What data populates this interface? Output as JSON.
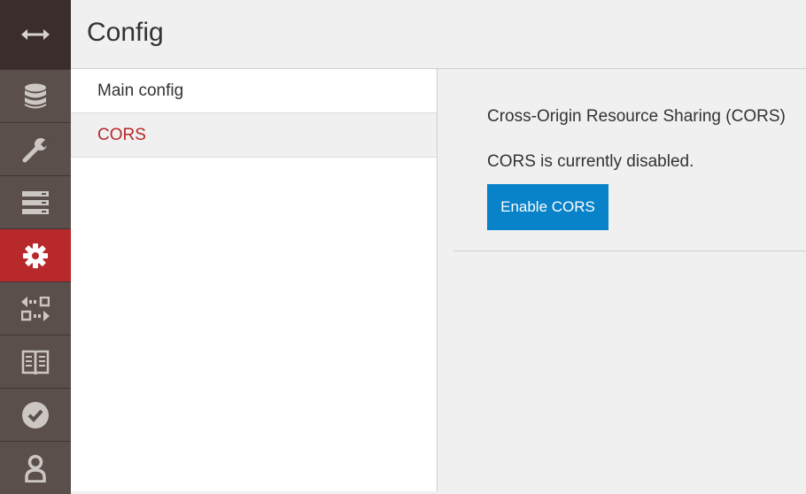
{
  "header": {
    "title": "Config"
  },
  "rail": {
    "items": [
      {
        "icon": "toggle-sidebar-icon"
      },
      {
        "icon": "database-icon"
      },
      {
        "icon": "wrench-icon"
      },
      {
        "icon": "server-icon"
      },
      {
        "icon": "gear-icon",
        "active": true
      },
      {
        "icon": "replication-icon"
      },
      {
        "icon": "book-icon"
      },
      {
        "icon": "check-circle-icon"
      },
      {
        "icon": "user-icon"
      }
    ],
    "active_color": "#b7292a"
  },
  "subnav": {
    "items": [
      {
        "label": "Main config"
      },
      {
        "label": "CORS",
        "active": true
      }
    ]
  },
  "main": {
    "section_title": "Cross-Origin Resource Sharing (CORS)",
    "status_text": "CORS is currently disabled.",
    "enable_button_label": "Enable CORS",
    "button_color": "#0882c8"
  }
}
